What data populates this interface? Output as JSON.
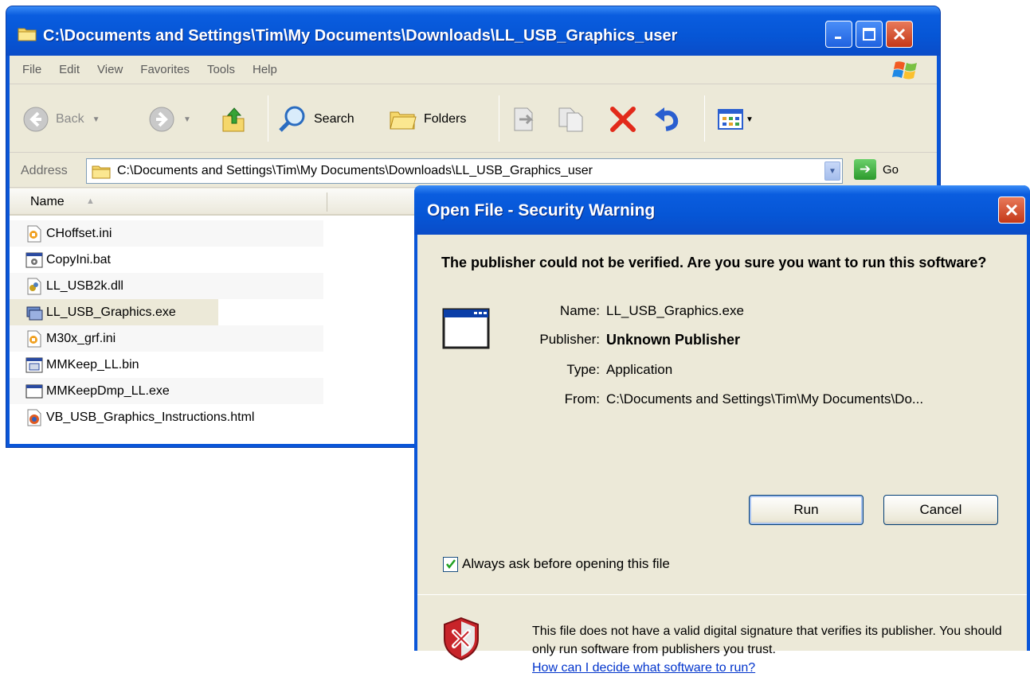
{
  "explorer": {
    "title": "C:\\Documents and Settings\\Tim\\My Documents\\Downloads\\LL_USB_Graphics_user",
    "menu": [
      "File",
      "Edit",
      "View",
      "Favorites",
      "Tools",
      "Help"
    ],
    "toolbar": {
      "back_label": "Back",
      "search_label": "Search",
      "folders_label": "Folders"
    },
    "address": {
      "label": "Address",
      "value": "C:\\Documents and Settings\\Tim\\My Documents\\Downloads\\LL_USB_Graphics_user",
      "go_label": "Go"
    },
    "columns": {
      "name": "Name"
    },
    "files": [
      {
        "name": "CHoffset.ini",
        "icon": "ini-file-icon"
      },
      {
        "name": "CopyIni.bat",
        "icon": "batch-file-icon"
      },
      {
        "name": "LL_USB2k.dll",
        "icon": "dll-file-icon"
      },
      {
        "name": "LL_USB_Graphics.exe",
        "icon": "exe-file-icon"
      },
      {
        "name": "M30x_grf.ini",
        "icon": "ini-file-icon"
      },
      {
        "name": "MMKeep_LL.bin",
        "icon": "bin-file-icon"
      },
      {
        "name": "MMKeepDmp_LL.exe",
        "icon": "window-exe-icon"
      },
      {
        "name": "VB_USB_Graphics_Instructions.html",
        "icon": "html-file-icon"
      }
    ]
  },
  "dialog": {
    "title": "Open File - Security Warning",
    "heading": "The publisher could not be verified.  Are you sure you want to run this software?",
    "fields": {
      "name_key": "Name:",
      "name_value": "LL_USB_Graphics.exe",
      "publisher_key": "Publisher:",
      "publisher_value": "Unknown Publisher",
      "type_key": "Type:",
      "type_value": "Application",
      "from_key": "From:",
      "from_value": "C:\\Documents and Settings\\Tim\\My Documents\\Do..."
    },
    "run_label": "Run",
    "cancel_label": "Cancel",
    "checkbox_label": "Always ask before opening this file",
    "checkbox_checked": true,
    "warning_text": "This file does not have a valid digital signature that verifies its publisher.  You should only run software from publishers you trust.",
    "warning_link": "How can I decide what software to run?"
  },
  "colors": {
    "titlebar_blue": "#0a56d8",
    "window_face": "#ece9d8",
    "close_red": "#c43818",
    "link_blue": "#0033cc"
  }
}
